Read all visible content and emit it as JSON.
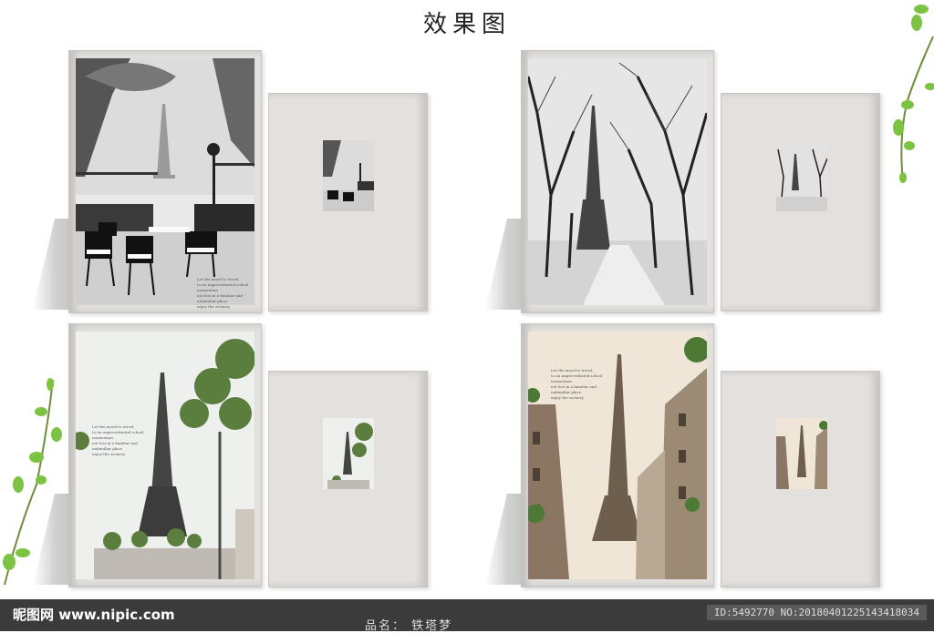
{
  "title": "效果图",
  "quote": "Let the mood to travel,\nto an unprecedented school momentum\nnot lost in a familiar and unfamiliar place\nenjoy the scenery.",
  "footer": {
    "logo": "昵图网 www.nipic.com",
    "id_text": "ID:5492770 NO:20180401225143418034",
    "product_label": "品名：",
    "product_name": "铁塔梦"
  },
  "colors": {
    "page": "#e3e0dd",
    "footer": "#3b3b3b",
    "leaf": "#7cc243"
  }
}
